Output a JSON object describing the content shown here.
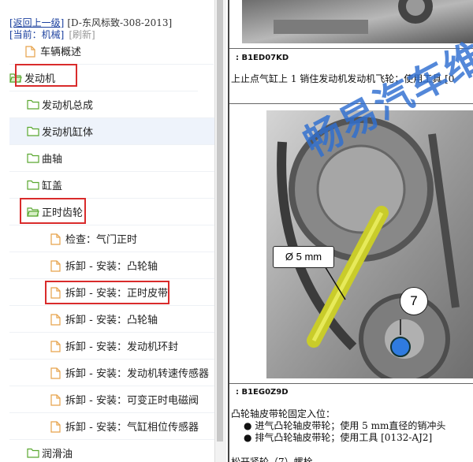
{
  "header": {
    "back_link": "[返回上一级]",
    "path": "[D-东风标致-308-2013]",
    "current": "[当前：机械]",
    "refresh": "[刷新]"
  },
  "tree": [
    {
      "label": "车辆概述",
      "icon": "file-icon"
    },
    {
      "label": "发动机",
      "icon": "folder-open-icon"
    },
    {
      "label": "发动机总成",
      "icon": "folder-icon"
    },
    {
      "label": "发动机缸体",
      "icon": "folder-icon"
    },
    {
      "label": "曲轴",
      "icon": "folder-icon"
    },
    {
      "label": "缸盖",
      "icon": "folder-icon"
    },
    {
      "label": "正时齿轮",
      "icon": "folder-open-icon"
    },
    {
      "label": "检查：气门正时",
      "icon": "file-icon"
    },
    {
      "label": "拆卸 - 安装：凸轮轴",
      "icon": "file-icon"
    },
    {
      "label": "拆卸 - 安装：正时皮带",
      "icon": "file-icon"
    },
    {
      "label": "拆卸 - 安装：凸轮轴",
      "icon": "file-icon"
    },
    {
      "label": "拆卸 - 安装：发动机环封",
      "icon": "file-icon"
    },
    {
      "label": "拆卸 - 安装：发动机转速传感器",
      "icon": "file-icon"
    },
    {
      "label": "拆卸 - 安装：可变正时电磁阀",
      "icon": "file-icon"
    },
    {
      "label": "拆卸 - 安装：气缸相位传感器",
      "icon": "file-icon"
    },
    {
      "label": "润滑油",
      "icon": "folder-icon"
    }
  ],
  "doc": {
    "caption1": ": B1ED07KD",
    "line1": "上止点气缸上 1 销住发动机发动机飞轮；使用工具 [0",
    "watermark": "畅易汽车维",
    "pin_label": "Ø 5 mm",
    "callout": "7",
    "caption2": ": B1EG0Z9D",
    "line2": "凸轮轴皮带轮固定入位：",
    "bullet1": "进气凸轮轴皮带轮；使用 5 mm直径的销冲头",
    "bullet2": "排气凸轮轴皮带轮；使用工具 [0132-AJ2]",
    "line3": "松开紧轮（7）螺栓"
  },
  "colors": {
    "link": "#1a3f9e",
    "highlight": "#d92b2b",
    "folder": "#5aa830",
    "file": "#e6a24a",
    "watermark": "#2f6fd1",
    "pin": "#c9cc2a"
  }
}
